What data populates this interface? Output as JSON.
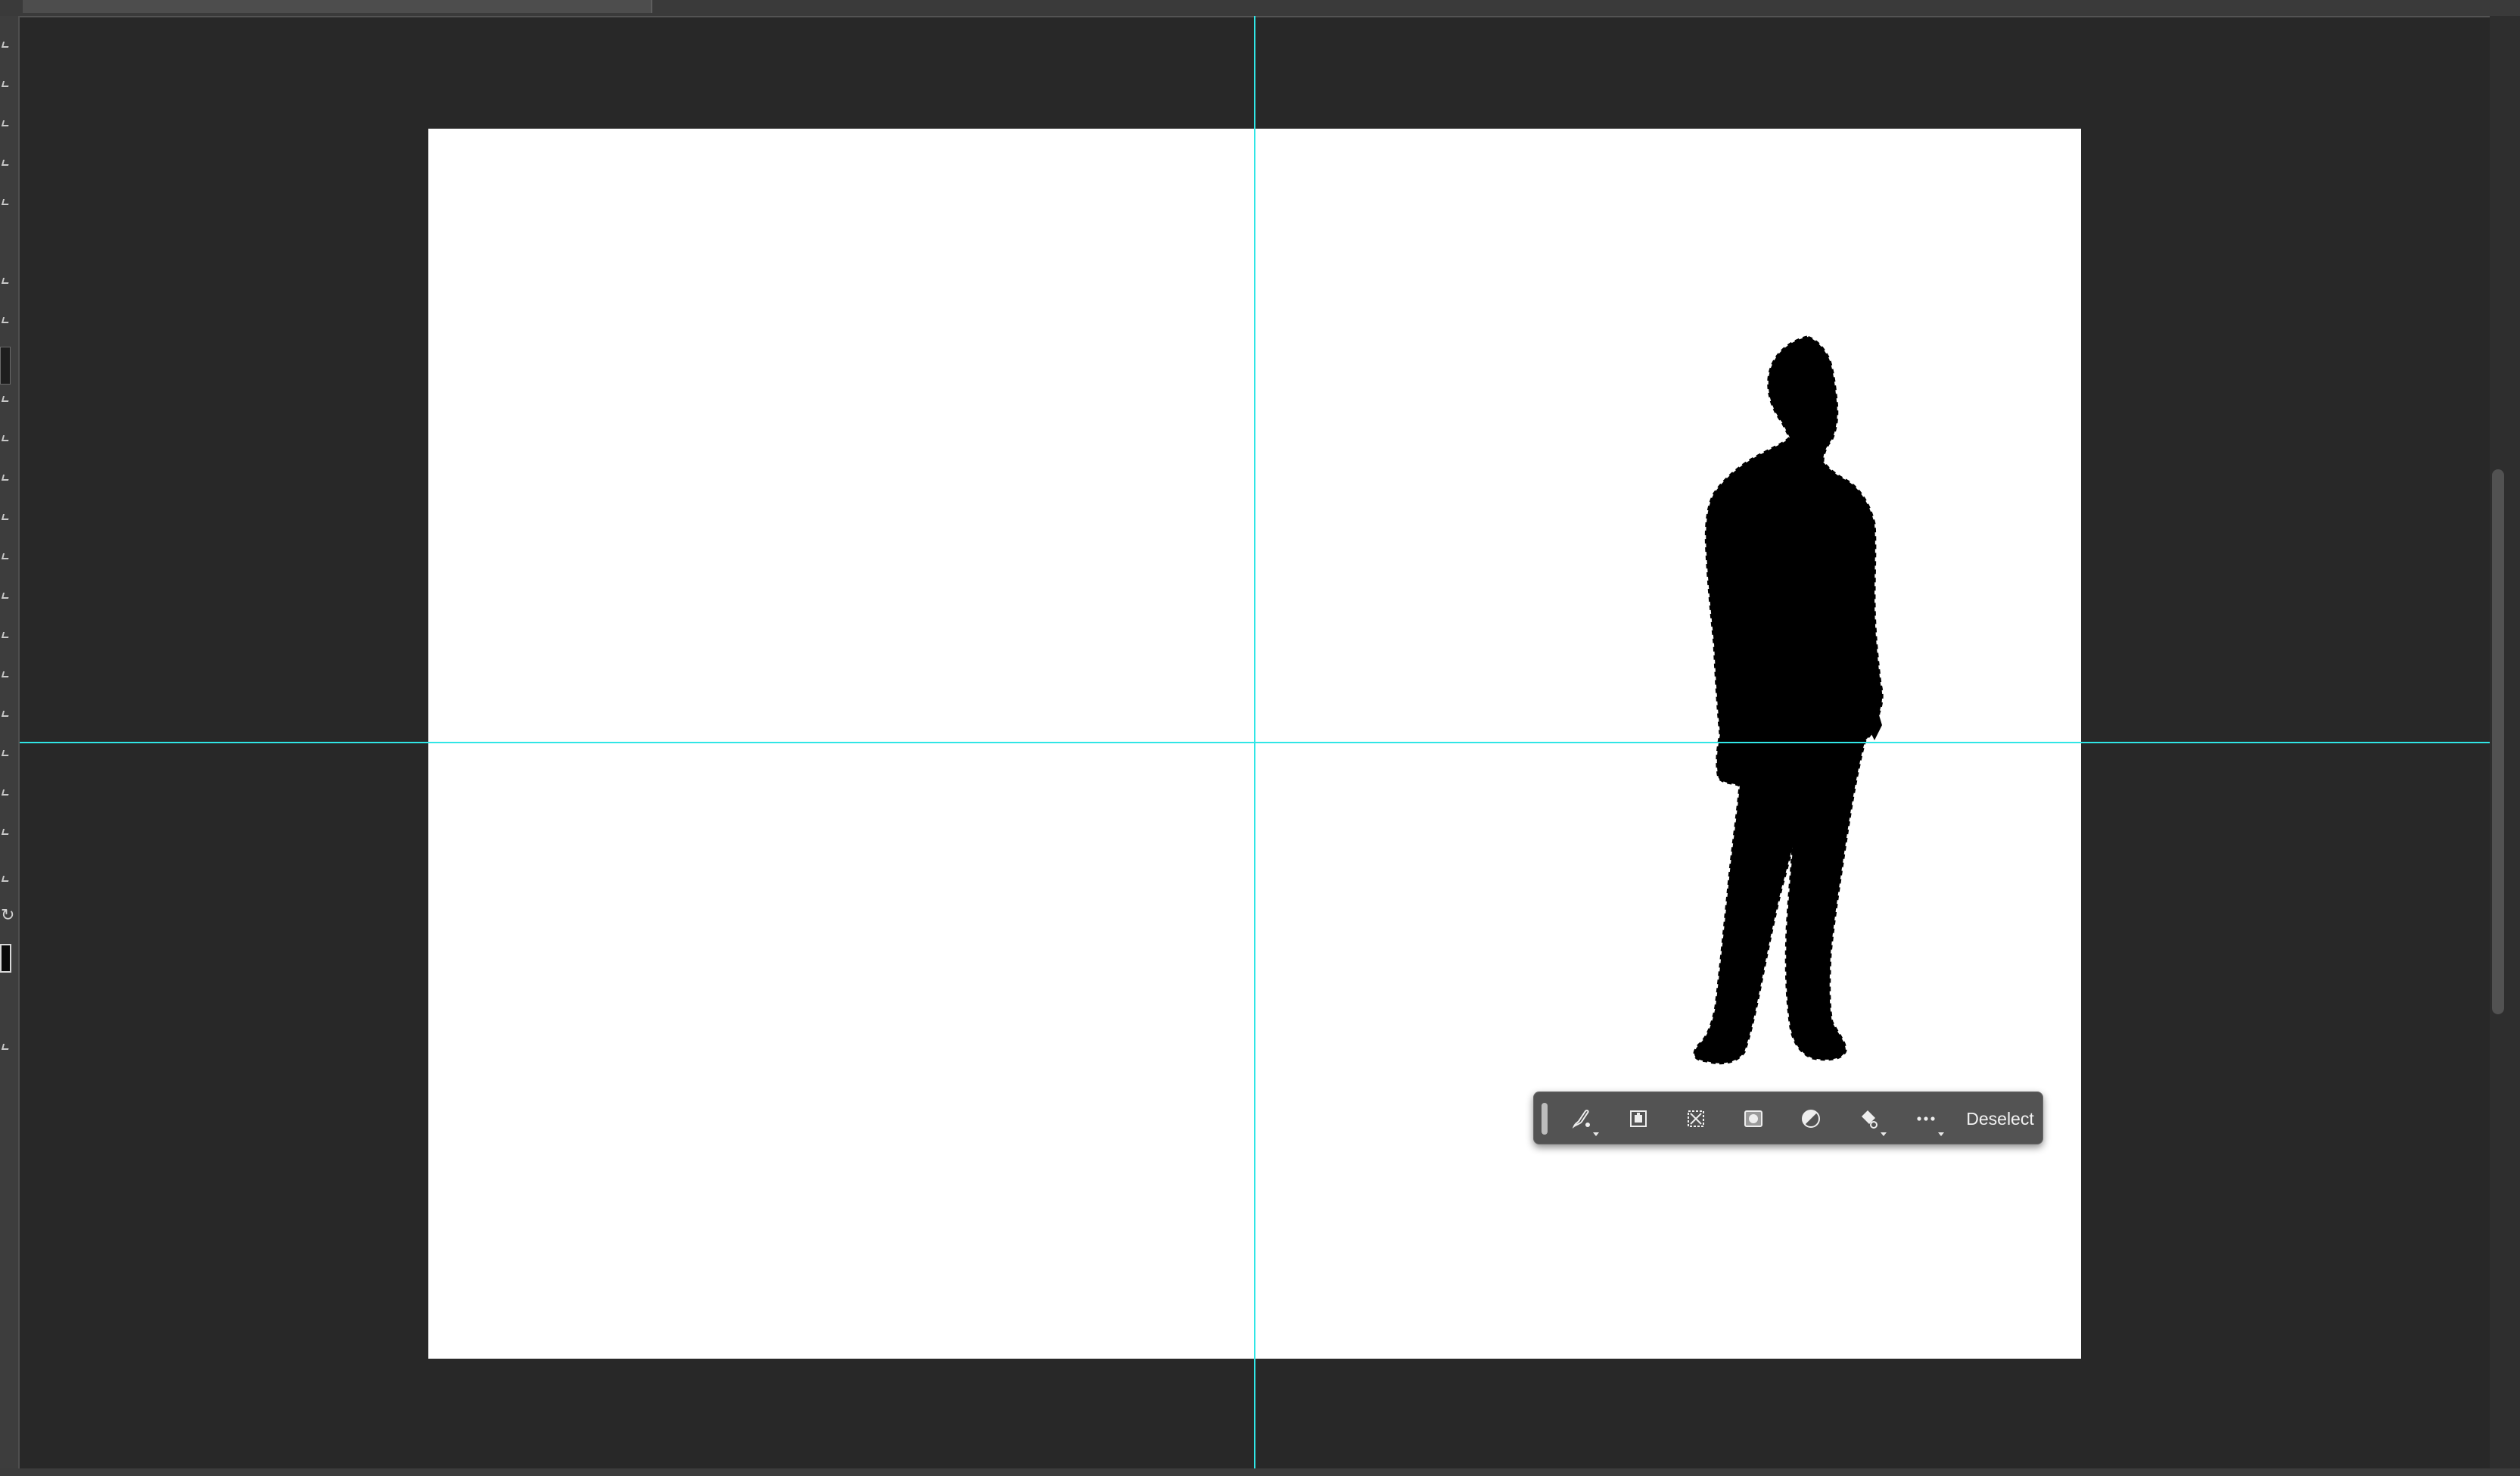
{
  "document_tab": {
    "title": ""
  },
  "contextual_taskbar": {
    "buttons": [
      {
        "name": "brush-mask-icon",
        "has_menu": true
      },
      {
        "name": "invert-selection-icon",
        "has_menu": false
      },
      {
        "name": "transform-selection-icon",
        "has_menu": false
      },
      {
        "name": "create-mask-icon",
        "has_menu": false
      },
      {
        "name": "adjustment-layer-icon",
        "has_menu": false
      },
      {
        "name": "fill-selection-icon",
        "has_menu": true
      },
      {
        "name": "more-options-icon",
        "has_menu": true
      }
    ],
    "deselect_label": "Deselect"
  },
  "colors": {
    "guide": "#30e6e6",
    "canvas_background": "#282828",
    "document": "#ffffff",
    "silhouette": "#000000"
  },
  "tools": [
    "move-tool-icon",
    "marquee-tool-icon",
    "lasso-tool-icon",
    "quick-selection-tool-icon",
    "crop-tool-icon",
    "frame-tool-icon",
    "eyedropper-tool-icon",
    "healing-brush-tool-icon",
    "brush-tool-icon",
    "clone-stamp-tool-icon",
    "history-brush-tool-icon",
    "eraser-tool-icon",
    "gradient-tool-icon",
    "blur-tool-icon",
    "dodge-tool-icon",
    "pen-tool-icon",
    "type-tool-icon",
    "path-selection-tool-icon",
    "rectangle-tool-icon",
    "hand-tool-icon",
    "zoom-tool-icon"
  ]
}
